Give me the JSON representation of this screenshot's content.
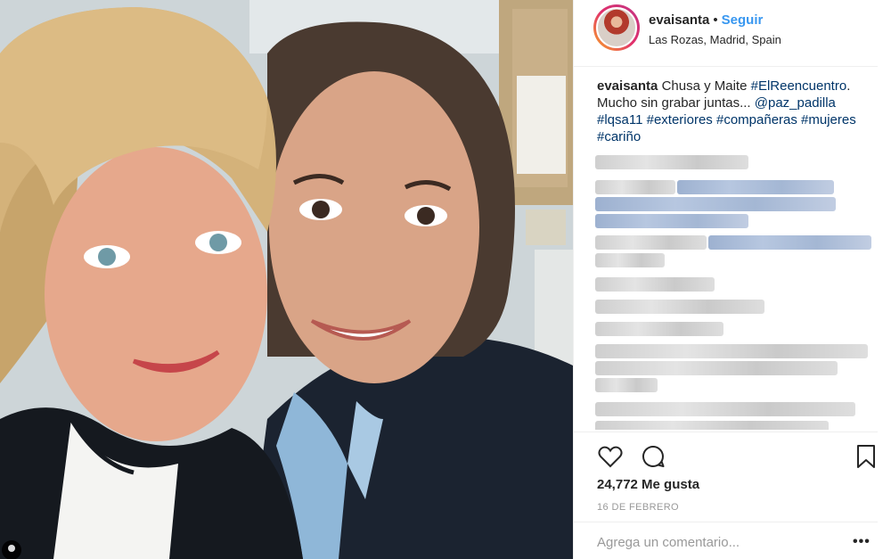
{
  "post": {
    "username": "evaisanta",
    "separator": "•",
    "follow_label": "Seguir",
    "location": "Las Rozas, Madrid, Spain",
    "caption": {
      "user": "evaisanta",
      "text_1": "Chusa y Maite",
      "tag_1": "#ElReencuentro",
      "text_2": ". Mucho sin grabar juntas...",
      "mention": "@paz_padilla",
      "tag_2": "#lqsa11",
      "tag_3": "#exteriores",
      "tag_4": "#compañeras",
      "tag_5": "#mujeres",
      "tag_6": "#cariño"
    },
    "likes": "24,772 Me gusta",
    "date": "16 DE FEBRERO",
    "comment_placeholder": "Agrega un comentario...",
    "more_options": "•••"
  },
  "icons": {
    "like": "heart-icon",
    "comment": "speech-bubble-icon",
    "save": "bookmark-icon",
    "options": "more-options-icon",
    "tagged_people": "user-tag-icon"
  },
  "colors": {
    "link": "#3897f0",
    "hashtag": "#003569",
    "text": "#262626",
    "muted": "#999999",
    "border": "#efefef"
  }
}
